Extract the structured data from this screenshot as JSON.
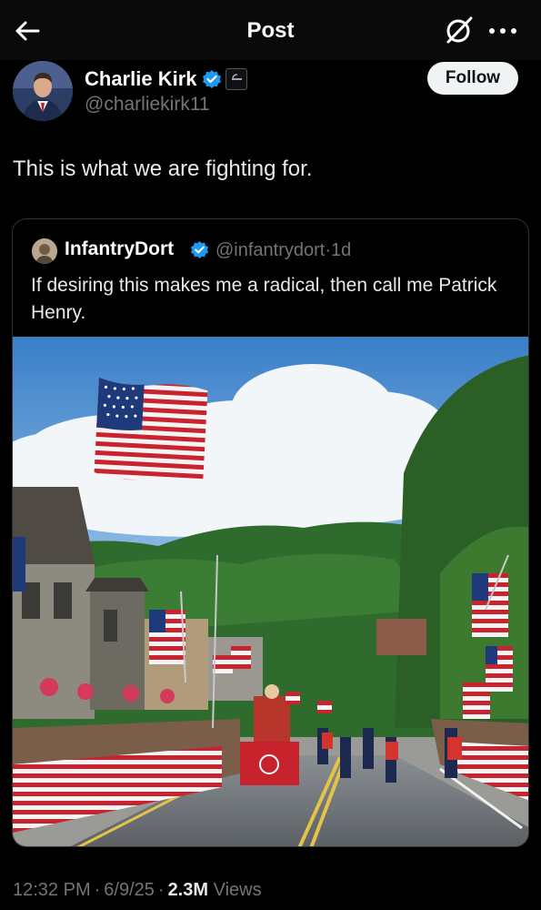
{
  "header": {
    "title": "Post"
  },
  "post": {
    "author_name": "Charlie Kirk",
    "author_handle": "@charliekirk11",
    "follow_label": "Follow",
    "text": "This is what we are fighting for."
  },
  "quote": {
    "author_name": "InfantryDort",
    "author_handle": "@infantrydort",
    "time": "1d",
    "text": "If desiring this makes me a radical, then call me Patrick Henry."
  },
  "meta": {
    "time": "12:32 PM",
    "date": "6/9/25",
    "views_count": "2.3M",
    "views_label": "Views"
  },
  "colors": {
    "verified": "#1d9bf0",
    "muted": "#71767b",
    "follow_bg": "#eff3f4"
  }
}
